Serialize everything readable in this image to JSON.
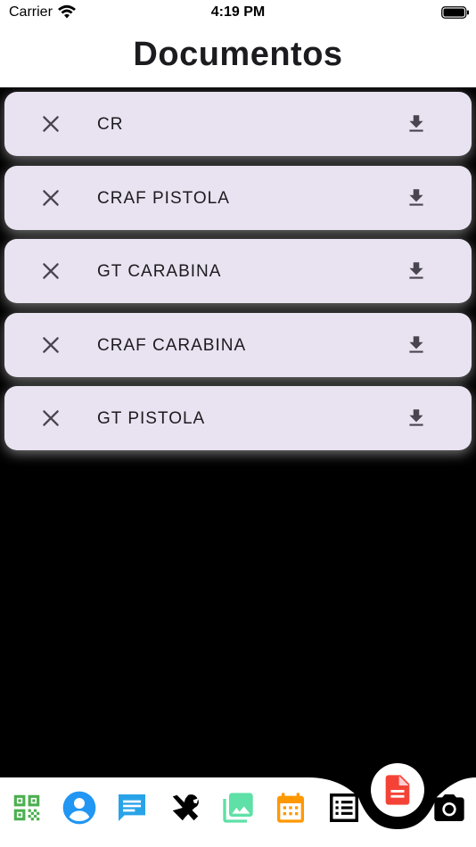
{
  "status_bar": {
    "carrier": "Carrier",
    "time": "4:19 PM"
  },
  "header": {
    "title": "Documentos"
  },
  "documents": [
    {
      "label": "CR"
    },
    {
      "label": "CRAF PISTOLA"
    },
    {
      "label": "GT CARABINA"
    },
    {
      "label": "CRAF CARABINA"
    },
    {
      "label": "GT PISTOLA"
    }
  ],
  "bottom_nav": {
    "items": [
      {
        "icon": "qr-code-icon",
        "color": "#4caf50"
      },
      {
        "icon": "account-circle-icon",
        "color": "#2196f3"
      },
      {
        "icon": "chat-icon",
        "color": "#29a3e8"
      },
      {
        "icon": "tools-icon",
        "color": "#000000"
      },
      {
        "icon": "photo-library-icon",
        "color": "#5fe0a6"
      },
      {
        "icon": "calendar-icon",
        "color": "#ff9800"
      },
      {
        "icon": "list-document-icon",
        "color": "#000000"
      },
      {
        "icon": "camera-icon",
        "color": "#000000"
      }
    ],
    "active": {
      "icon": "document-icon",
      "color": "#f44336"
    }
  },
  "colors": {
    "card_background": "#e9e2f0",
    "icon": "#49454f",
    "background": "#000000"
  }
}
